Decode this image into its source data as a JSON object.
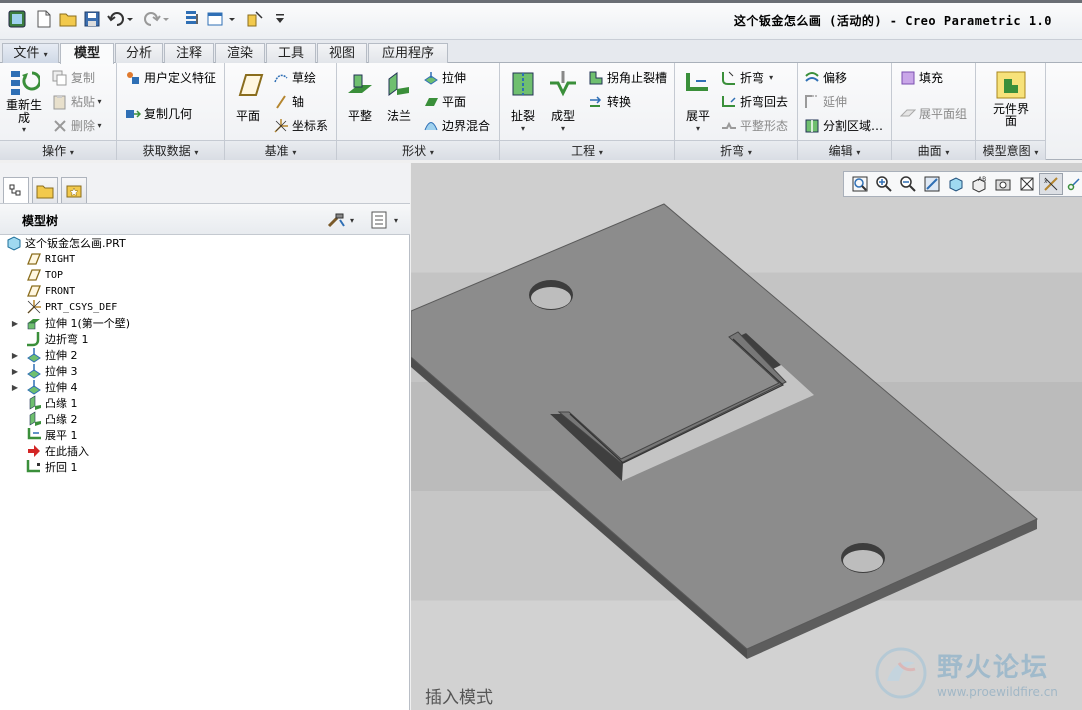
{
  "window": {
    "title": "这个钣金怎么画 (活动的) - Creo Parametric 1.0"
  },
  "menu_tabs": [
    {
      "label": "文件",
      "arrow": "▾"
    },
    {
      "label": "模型"
    },
    {
      "label": "分析"
    },
    {
      "label": "注释"
    },
    {
      "label": "渲染"
    },
    {
      "label": "工具"
    },
    {
      "label": "视图"
    },
    {
      "label": "应用程序"
    }
  ],
  "ribbon": {
    "groups": {
      "operations": "操作",
      "get_data": "获取数据",
      "datum": "基准",
      "shapes": "形状",
      "engineering": "工程",
      "bends": "折弯",
      "editing": "编辑",
      "surfaces": "曲面",
      "model_intent": "模型意图"
    },
    "buttons": {
      "regenerate": "重新生成",
      "copy": "复制",
      "paste": "粘贴",
      "delete": "删除",
      "user_defined_feature": "用户定义特征",
      "copy_geometry": "复制几何",
      "plane": "平面",
      "sketch": "草绘",
      "axis": "轴",
      "csys": "坐标系",
      "planar": "平整",
      "flange": "法兰",
      "extrude": "拉伸",
      "flat": "平面",
      "boundary_blend": "边界混合",
      "rip": "扯裂",
      "form": "成型",
      "corner_relief": "拐角止裂槽",
      "convert": "转换",
      "unbend": "展平",
      "bend": "折弯",
      "bend_back": "折弯回去",
      "flatten_form": "平整形态",
      "offset": "偏移",
      "extend": "延伸",
      "split_area": "分割区域…",
      "fill": "填充",
      "flat_pattern": "展平面组",
      "component_interface": "元件界面"
    }
  },
  "left_panel": {
    "tree_title": "模型树",
    "items": [
      {
        "label": "这个钣金怎么画.PRT",
        "icon": "part-icon"
      },
      {
        "label": "RIGHT",
        "icon": "datum-plane-icon"
      },
      {
        "label": "TOP",
        "icon": "datum-plane-icon"
      },
      {
        "label": "FRONT",
        "icon": "datum-plane-icon"
      },
      {
        "label": "PRT_CSYS_DEF",
        "icon": "csys-icon"
      },
      {
        "label": "拉伸 1(第一个壁)",
        "icon": "extrude-wall-icon",
        "expand": "▶"
      },
      {
        "label": "边折弯 1",
        "icon": "edge-bend-icon"
      },
      {
        "label": "拉伸 2",
        "icon": "extrude-icon",
        "expand": "▶"
      },
      {
        "label": "拉伸 3",
        "icon": "extrude-icon",
        "expand": "▶"
      },
      {
        "label": "拉伸 4",
        "icon": "extrude-icon",
        "expand": "▶"
      },
      {
        "label": "凸缘 1",
        "icon": "flange-icon"
      },
      {
        "label": "凸缘 2",
        "icon": "flange-icon"
      },
      {
        "label": "展平 1",
        "icon": "unbend-icon"
      },
      {
        "label": "在此插入",
        "icon": "insert-here-icon"
      },
      {
        "label": "折回 1",
        "icon": "bend-back-icon"
      }
    ]
  },
  "viewport": {
    "mode_text": "插入模式",
    "watermark_title": "野火论坛",
    "watermark_url": "www.proewildfire.cn"
  },
  "colors": {
    "accent_blue": "#2f6fb5",
    "plate": "#8c8c8c",
    "plate_edge": "#5a5a5a"
  }
}
